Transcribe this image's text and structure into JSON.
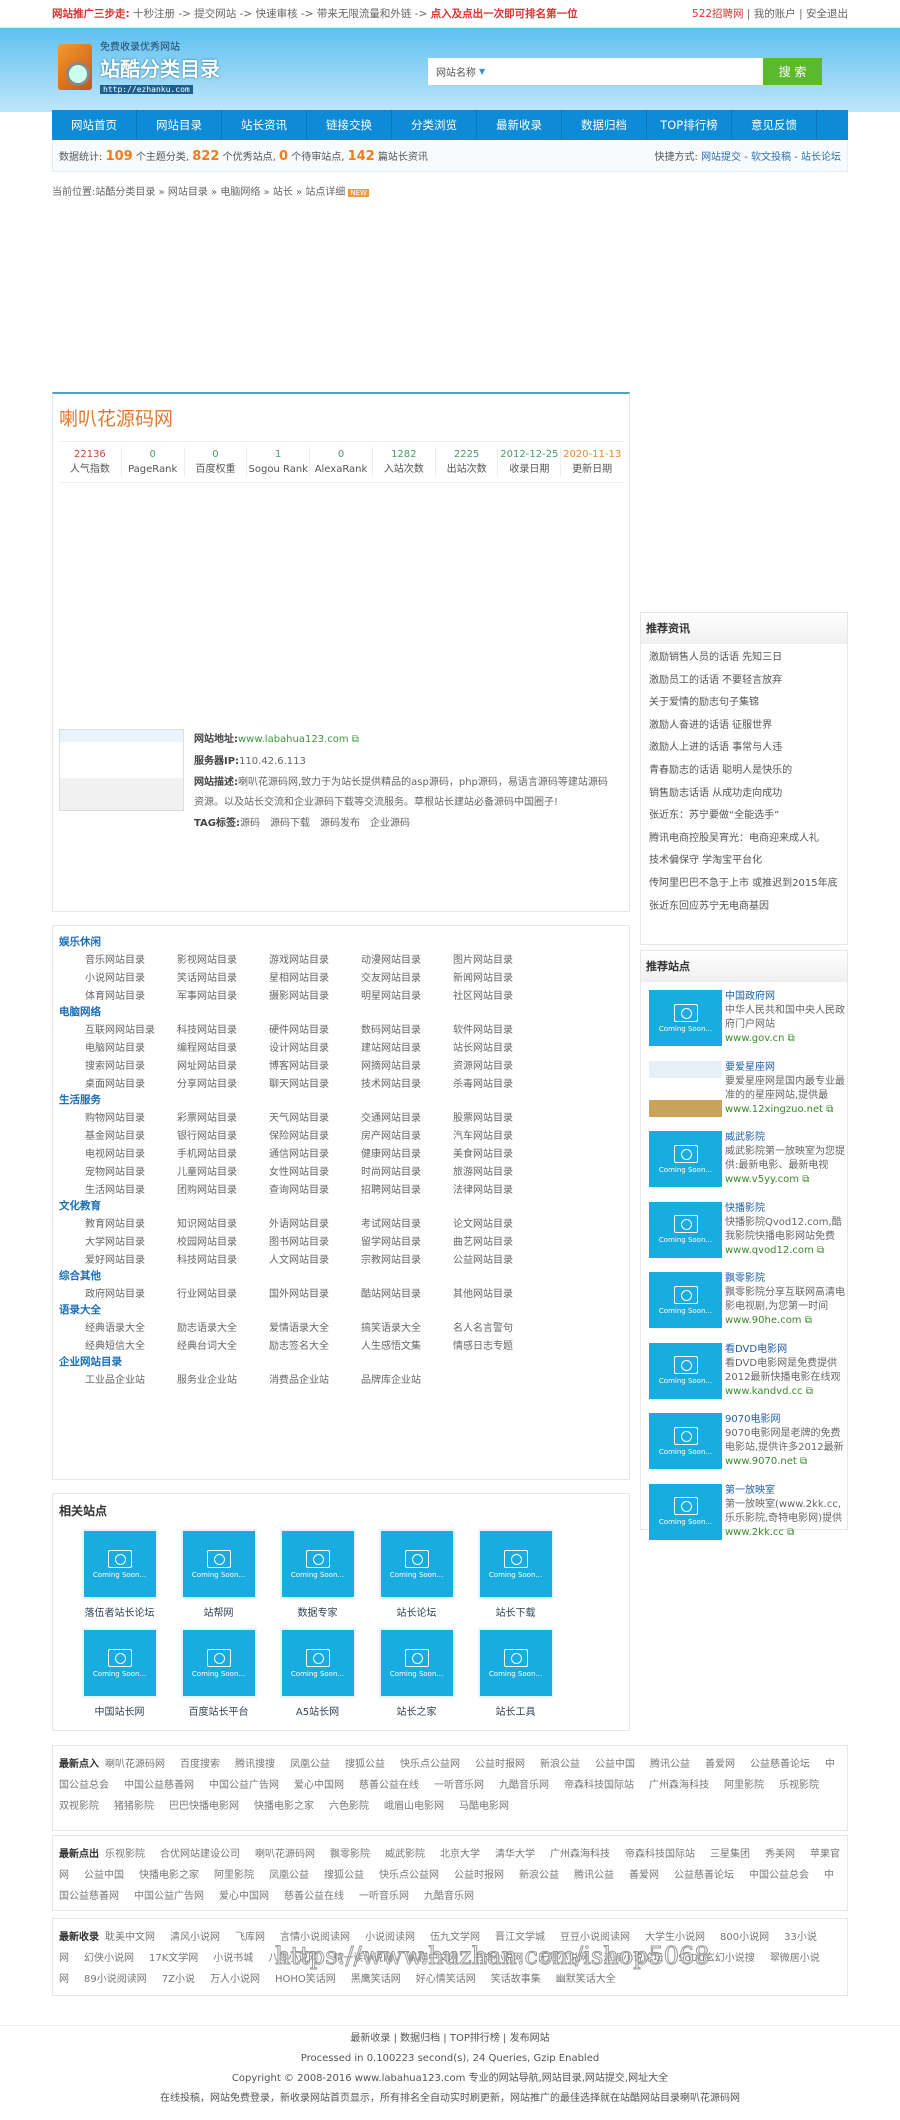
{
  "topbar": {
    "promo_label": "网站推广三步走:",
    "steps": "十秒注册 -> 提交网站 -> 快速审核 -> 带来无限流量和外链 ->",
    "promo_end": "点入及点出一次即可排名第一位",
    "user_link": "522招聘网",
    "account": "我的账户",
    "logout": "安全退出"
  },
  "logo": {
    "slogan": "免费收录优秀网站",
    "name": "站酷分类目录",
    "url": "http://ezhanku.com"
  },
  "search": {
    "select": "网站名称",
    "button": "搜 索"
  },
  "nav": [
    "网站首页",
    "网站目录",
    "站长资讯",
    "链接交换",
    "分类浏览",
    "最新收录",
    "数据归档",
    "TOP排行榜",
    "意见反馈"
  ],
  "stats": {
    "prefix": "数据统计:",
    "cats": "109",
    "cats_l": "个主题分类,",
    "sites": "822",
    "sites_l": "个优秀站点,",
    "pending": "0",
    "pending_l": "个待审站点,",
    "articles": "142",
    "articles_l": "篇站长资讯",
    "quick": "快捷方式:",
    "q1": "网站提交",
    "q2": "软文投稿",
    "q3": "站长论坛"
  },
  "breadcrumb": {
    "prefix": "当前位置:",
    "items": [
      "站酷分类目录",
      "网站目录",
      "电脑网络",
      "站长",
      "站点详细"
    ],
    "badge": "NEW"
  },
  "detail": {
    "title": "喇叭花源码网",
    "metrics": [
      {
        "v": "22136",
        "l": "人气指数"
      },
      {
        "v": "0",
        "l": "PageRank"
      },
      {
        "v": "0",
        "l": "百度权重"
      },
      {
        "v": "1",
        "l": "Sogou Rank"
      },
      {
        "v": "0",
        "l": "AlexaRank"
      },
      {
        "v": "1282",
        "l": "入站次数"
      },
      {
        "v": "2225",
        "l": "出站次数"
      },
      {
        "v": "2012-12-25",
        "l": "收录日期"
      },
      {
        "v": "2020-11-13",
        "l": "更新日期"
      }
    ],
    "url_label": "网站地址:",
    "url": "www.labahua123.com",
    "ip_label": "服务器IP:",
    "ip": "110.42.6.113",
    "desc_label": "网站描述:",
    "desc": "喇叭花源码网,致力于为站长提供精品的asp源码，php源码，易语言源码等建站源码资源。以及站长交流和企业源码下载等交流服务。草根站长建站必备源码中国圈子!",
    "tag_label": "TAG标签:",
    "tags": [
      "源码",
      "源码下载",
      "源码发布",
      "企业源码"
    ]
  },
  "categories": [
    {
      "name": "娱乐休闲",
      "items": [
        "音乐网站目录",
        "影视网站目录",
        "游戏网站目录",
        "动漫网站目录",
        "图片网站目录",
        "小说网站目录",
        "笑话网站目录",
        "星相网站目录",
        "交友网站目录",
        "新闻网站目录",
        "体育网站目录",
        "军事网站目录",
        "摄影网站目录",
        "明星网站目录",
        "社区网站目录"
      ]
    },
    {
      "name": "电脑网络",
      "items": [
        "互联网网站目录",
        "科技网站目录",
        "硬件网站目录",
        "数码网站目录",
        "软件网站目录",
        "电脑网站目录",
        "编程网站目录",
        "设计网站目录",
        "建站网站目录",
        "站长网站目录",
        "搜索网站目录",
        "网址网站目录",
        "博客网站目录",
        "网摘网站目录",
        "资源网站目录",
        "桌面网站目录",
        "分享网站目录",
        "聊天网站目录",
        "技术网站目录",
        "杀毒网站目录"
      ]
    },
    {
      "name": "生活服务",
      "items": [
        "购物网站目录",
        "彩票网站目录",
        "天气网站目录",
        "交通网站目录",
        "股票网站目录",
        "基金网站目录",
        "银行网站目录",
        "保险网站目录",
        "房产网站目录",
        "汽车网站目录",
        "电视网站目录",
        "手机网站目录",
        "通信网站目录",
        "健康网站目录",
        "美食网站目录",
        "宠物网站目录",
        "儿童网站目录",
        "女性网站目录",
        "时尚网站目录",
        "旅游网站目录",
        "生活网站目录",
        "团购网站目录",
        "查询网站目录",
        "招聘网站目录",
        "法律网站目录"
      ]
    },
    {
      "name": "文化教育",
      "items": [
        "教育网站目录",
        "知识网站目录",
        "外语网站目录",
        "考试网站目录",
        "论文网站目录",
        "大学网站目录",
        "校园网站目录",
        "图书网站目录",
        "留学网站目录",
        "曲艺网站目录",
        "爱好网站目录",
        "科技网站目录",
        "人文网站目录",
        "宗教网站目录",
        "公益网站目录"
      ]
    },
    {
      "name": "综合其他",
      "items": [
        "政府网站目录",
        "行业网站目录",
        "国外网站目录",
        "酷站网站目录",
        "其他网站目录"
      ]
    },
    {
      "name": "语录大全",
      "items": [
        "经典语录大全",
        "励志语录大全",
        "爱情语录大全",
        "搞笑语录大全",
        "名人名言警句",
        "经典短信大全",
        "经典台词大全",
        "励志签名大全",
        "人生感悟文集",
        "情感日志专题"
      ]
    },
    {
      "name": "企业网站目录",
      "items": [
        "工业品企业站",
        "服务业企业站",
        "消费品企业站",
        "品牌库企业站"
      ]
    }
  ],
  "related": {
    "title": "相关站点",
    "placeholder": "Coming Soon...",
    "items": [
      "落伍者站长论坛",
      "站帮网",
      "数据专家",
      "站长论坛",
      "站长下载",
      "中国站长网",
      "百度站长平台",
      "A5站长网",
      "站长之家",
      "站长工具"
    ]
  },
  "news": {
    "title": "推荐资讯",
    "items": [
      "激励销售人员的话语 先知三日",
      "激励员工的话语 不要轻言放弃",
      "关于爱情的励志句子集锦",
      "激励人奋进的话语 征服世界",
      "激励人上进的话语 事常与人违",
      "青春励志的话语 聪明人是快乐的",
      "销售励志话语 从成功走向成功",
      "张近东：苏宁要做“全能选手”",
      "腾讯电商控股吴宵光：电商迎来成人礼",
      "技术偏保守 学淘宝平台化",
      "传阿里巴巴不急于上市 或推迟到2015年底",
      "张近东回应苏宁无电商基因"
    ]
  },
  "recommended": {
    "title": "推荐站点",
    "items": [
      {
        "name": "中国政府网",
        "desc": "中华人民共和国中央人民政府门户网站",
        "url": "www.gov.cn"
      },
      {
        "name": "要爱星座网",
        "desc": "要爱星座网是国内最专业最准的的星座网站,提供最",
        "url": "www.12xingzuo.net",
        "shot": true
      },
      {
        "name": "威武影院",
        "desc": "威武影院第一放映室为您提供:最新电影、最新电视",
        "url": "www.v5yy.com"
      },
      {
        "name": "快播影院",
        "desc": "快播影院Qvod12.com,酷我影院快播电影网站免费",
        "url": "www.qvod12.com"
      },
      {
        "name": "飘零影院",
        "desc": "飘零影院分享互联网高清电影电视剧,为您第一时间",
        "url": "www.90he.com"
      },
      {
        "name": "看DVD电影网",
        "desc": "看DVD电影网是免费提供2012最新快播电影在线观",
        "url": "www.kandvd.cc"
      },
      {
        "name": "9070电影网",
        "desc": "9070电影网是老牌的免费电影站,提供许多2012最新",
        "url": "www.9070.net"
      },
      {
        "name": "第一放映室",
        "desc": "第一放映室(www.2kk.cc,乐乐影院,奇特电影网)提供",
        "url": "www.2kk.cc"
      }
    ]
  },
  "lists": [
    {
      "title": "最新点入",
      "items": [
        "喇叭花源码网",
        "百度搜索",
        "腾讯搜搜",
        "凤凰公益",
        "搜狐公益",
        "快乐点公益网",
        "公益时报网",
        "新浪公益",
        "公益中国",
        "腾讯公益",
        "善爱网",
        "公益慈善论坛",
        "中国公益总会",
        "中国公益慈善网",
        "中国公益广告网",
        "爱心中国网",
        "慈善公益在线",
        "一听音乐网",
        "九酷音乐网",
        "帝森科技国际站",
        "广州森海科技",
        "阿里影院",
        "乐视影院",
        "双视影院",
        "猪猪影院",
        "巴巴快播电影网",
        "快播电影之家",
        "六色影院",
        "峨眉山电影网",
        "马酷电影网"
      ]
    },
    {
      "title": "最新点出",
      "items": [
        "乐视影院",
        "合优网站建设公司",
        "喇叭花源码网",
        "飘零影院",
        "威武影院",
        "北京大学",
        "清华大学",
        "广州森海科技",
        "帝森科技国际站",
        "三星集团",
        "秀美网",
        "苹果官网",
        "公益中国",
        "快播电影之家",
        "阿里影院",
        "凤凰公益",
        "搜狐公益",
        "快乐点公益网",
        "公益时报网",
        "新浪公益",
        "腾讯公益",
        "善爱网",
        "公益慈善论坛",
        "中国公益总会",
        "中国公益慈善网",
        "中国公益广告网",
        "爱心中国网",
        "慈善公益在线",
        "一听音乐网",
        "九酷音乐网"
      ]
    },
    {
      "title": "最新收录",
      "items": [
        "耽美中文网",
        "清风小说网",
        "飞库网",
        "言情小说阅读网",
        "小说阅读网",
        "伍九文学网",
        "晋江文学城",
        "豆豆小说阅读网",
        "大学生小说网",
        "800小说网",
        "33小说网",
        "幻侠小说网",
        "17K文学网",
        "小说书城",
        "八零小说网",
        "精一读小说网",
        "纵横中文网",
        "书旗小说网",
        "无限小说网",
        "派派小说论坛",
        "SoDu玄幻小说搜",
        "翠微居小说网",
        "89小说阅读网",
        "7Z小说",
        "万人小说网",
        "HOHO笑话网",
        "黑鹰笑话网",
        "好心情笑话网",
        "笑话故事集",
        "幽默笑话大全"
      ]
    }
  ],
  "footer": {
    "links": [
      "最新收录",
      "数据归档",
      "TOP排行榜",
      "发布网站"
    ],
    "processed": "Processed in 0.100223 second(s), 24 Queries, Gzip Enabled",
    "copyright": "Copyright © 2008-2016 www.labahua123.com 专业的网站导航,网站目录,网站提交,网址大全",
    "tagline": "在线投稿，网站免费登录，新收录网站首页显示，所有排名全自动实时刷更新，网站推广的最佳选择就在站酷网站目录喇叭花源码网"
  },
  "watermark": "https://www.huzhan.com/ishop5068"
}
